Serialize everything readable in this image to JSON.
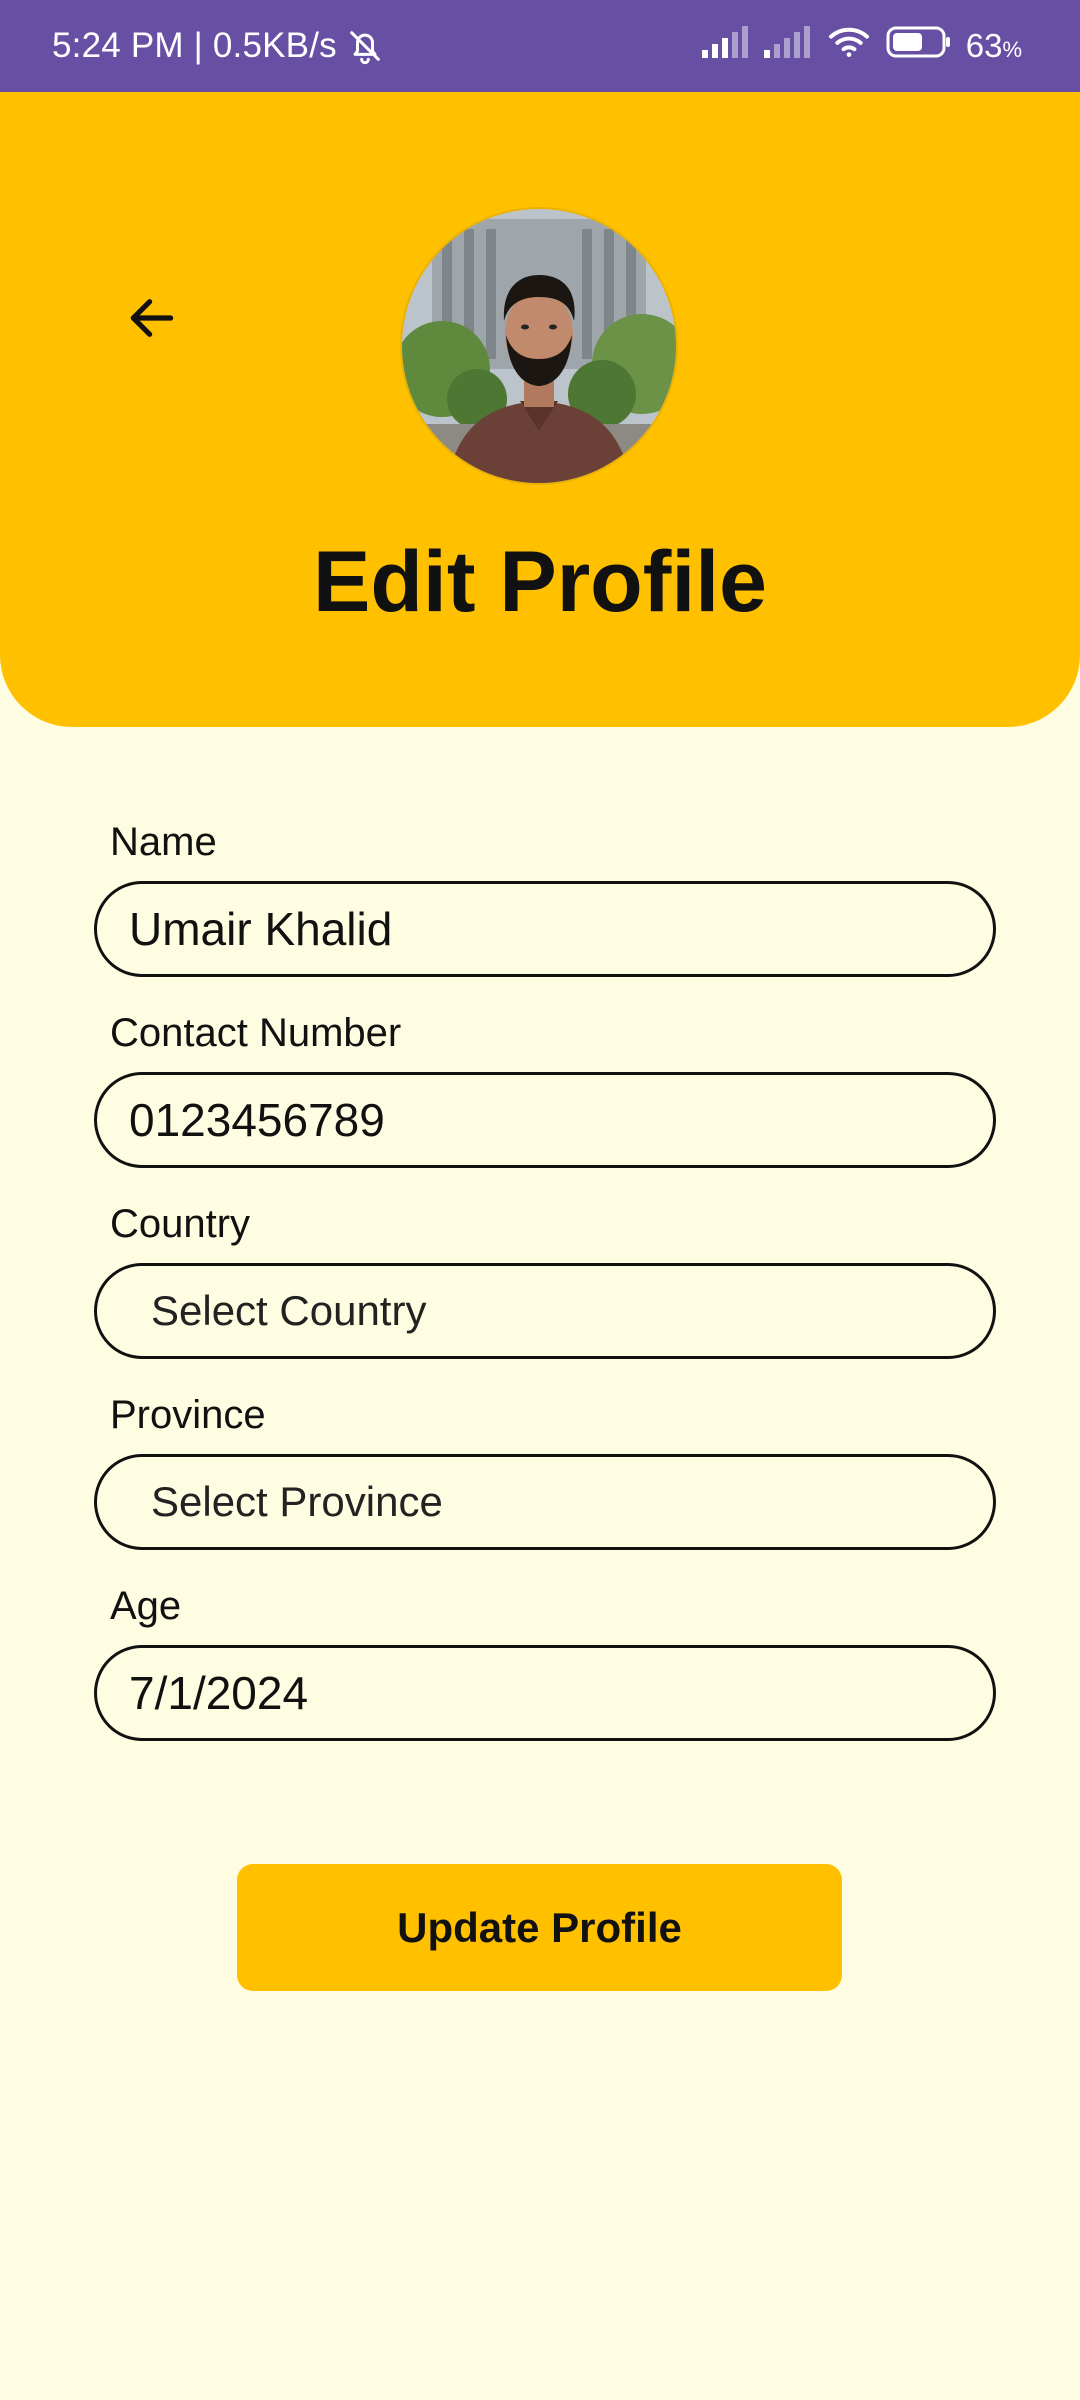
{
  "status_bar": {
    "time_speed": "5:24 PM | 0.5KB/s",
    "battery_value": "63",
    "battery_unit": "%",
    "battery_level": 0.63,
    "icons": [
      "bell-off-icon",
      "signal-icon",
      "signal-icon",
      "wifi-icon",
      "battery-icon"
    ]
  },
  "header": {
    "title": "Edit Profile",
    "back_icon": "arrow-left-icon",
    "avatar": "profile-photo"
  },
  "form": {
    "name_label": "Name",
    "name_value": "Umair Khalid",
    "contact_label": "Contact Number",
    "contact_value": "0123456789",
    "country_label": "Country",
    "country_value": "Select Country",
    "province_label": "Province",
    "province_value": "Select Province",
    "age_label": "Age",
    "age_value": "7/1/2024"
  },
  "actions": {
    "update_label": "Update Profile"
  },
  "colors": {
    "status_bar": "#6750A4",
    "header": "#FFC000",
    "background": "#FFFDE1",
    "button": "#FFC000"
  }
}
